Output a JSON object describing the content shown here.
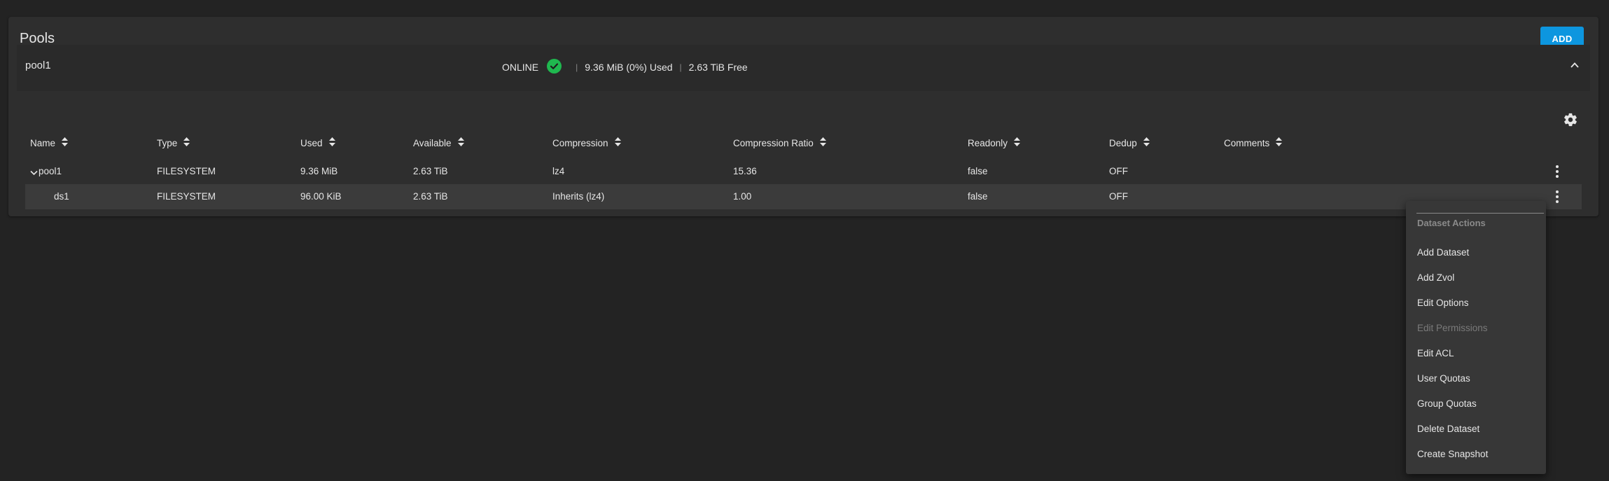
{
  "card": {
    "title": "Pools",
    "add_label": "ADD"
  },
  "pool": {
    "name": "pool1",
    "status": "ONLINE",
    "used": "9.36 MiB (0%) Used",
    "free": "2.63 TiB Free",
    "status_color": "#1fb84f"
  },
  "table": {
    "columns": [
      "Name",
      "Type",
      "Used",
      "Available",
      "Compression",
      "Compression Ratio",
      "Readonly",
      "Dedup",
      "Comments"
    ],
    "rows": [
      {
        "name": "pool1",
        "type": "FILESYSTEM",
        "used": "9.36 MiB",
        "available": "2.63 TiB",
        "compression": "lz4",
        "ratio": "15.36",
        "readonly": "false",
        "dedup": "OFF",
        "comments": ""
      },
      {
        "name": "ds1",
        "type": "FILESYSTEM",
        "used": "96.00 KiB",
        "available": "2.63 TiB",
        "compression": "Inherits (lz4)",
        "ratio": "1.00",
        "readonly": "false",
        "dedup": "OFF",
        "comments": ""
      }
    ]
  },
  "menu": {
    "header": "Dataset Actions",
    "items": [
      {
        "label": "Add Dataset",
        "disabled": false
      },
      {
        "label": "Add Zvol",
        "disabled": false
      },
      {
        "label": "Edit Options",
        "disabled": false
      },
      {
        "label": "Edit Permissions",
        "disabled": true
      },
      {
        "label": "Edit ACL",
        "disabled": false
      },
      {
        "label": "User Quotas",
        "disabled": false
      },
      {
        "label": "Group Quotas",
        "disabled": false
      },
      {
        "label": "Delete Dataset",
        "disabled": false
      },
      {
        "label": "Create Snapshot",
        "disabled": false
      }
    ]
  },
  "colors": {
    "accent": "#0d96df",
    "background": "#232323",
    "card": "#2e2e2e",
    "highlight_row": "#3b3b3b"
  }
}
